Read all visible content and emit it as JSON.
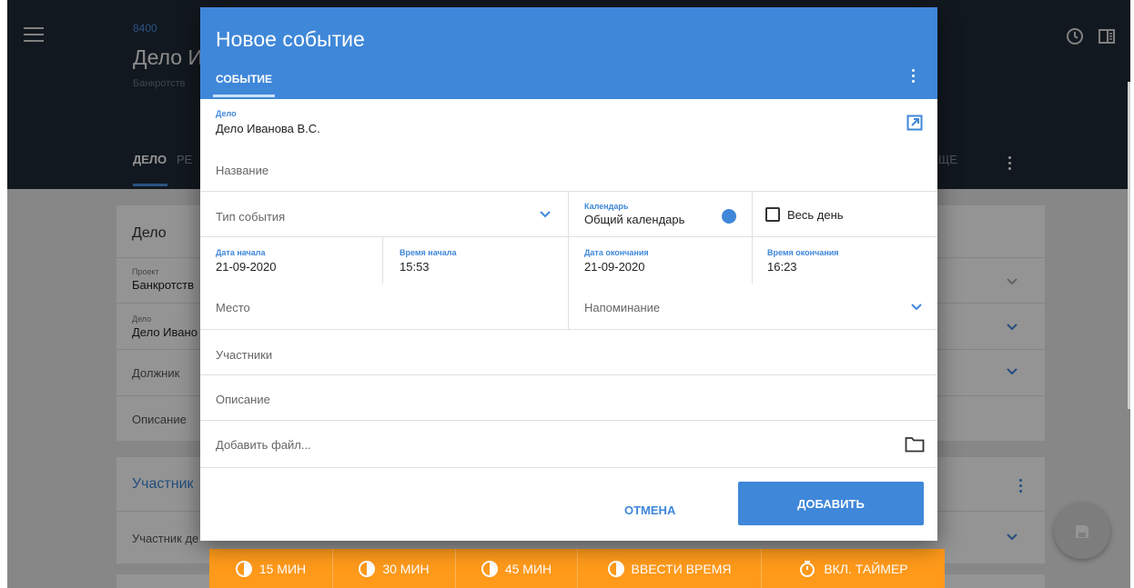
{
  "app": {
    "case_number": "8400",
    "case_title": "Дело И",
    "case_subtitle": "Банкротств",
    "tabs": {
      "delo": "ДЕЛО",
      "partial": "РЕ",
      "right_partial": "ЩЕ"
    }
  },
  "background": {
    "case_card": {
      "title": "Дело",
      "project_label": "Проект",
      "project_value": "Банкротств",
      "case_label": "Дело",
      "case_value": "Дело Ивано",
      "debtor": "Должник",
      "description": "Описание"
    },
    "participants_card": {
      "title": "Участник",
      "participant_row": "Участник де"
    }
  },
  "dialog": {
    "title": "Новое событие",
    "tab": "СОБЫТИЕ",
    "case_label": "Дело",
    "case_value": "Дело Иванова В.С.",
    "name_placeholder": "Название",
    "event_type_placeholder": "Тип события",
    "calendar_label": "Календарь",
    "calendar_value": "Общий календарь",
    "all_day_label": "Весь день",
    "start_date_label": "Дата начала",
    "start_date_value": "21-09-2020",
    "start_time_label": "Время начала",
    "start_time_value": "15:53",
    "end_date_label": "Дата окончания",
    "end_date_value": "21-09-2020",
    "end_time_label": "Время окончания",
    "end_time_value": "16:23",
    "place_placeholder": "Место",
    "reminder_placeholder": "Напоминание",
    "participants_placeholder": "Участники",
    "description_placeholder": "Описание",
    "add_file_placeholder": "Добавить файл...",
    "cancel_button": "ОТМЕНА",
    "add_button": "ДОБАВИТЬ"
  },
  "time_bar": {
    "btn_15": "15 МИН",
    "btn_30": "30 МИН",
    "btn_45": "45 МИН",
    "btn_enter": "ВВЕСТИ ВРЕМЯ",
    "btn_timer": "ВКЛ. ТАЙМЕР"
  },
  "colors": {
    "accent_blue": "#3f87d9",
    "orange": "#ff9a1a",
    "topbar": "#1f2a36"
  },
  "icons": [
    "menu-icon",
    "clock-icon",
    "panel-icon",
    "external-link-icon",
    "chevron-down-icon",
    "folder-icon",
    "save-icon",
    "timer-icon",
    "pie-clock-icon"
  ]
}
